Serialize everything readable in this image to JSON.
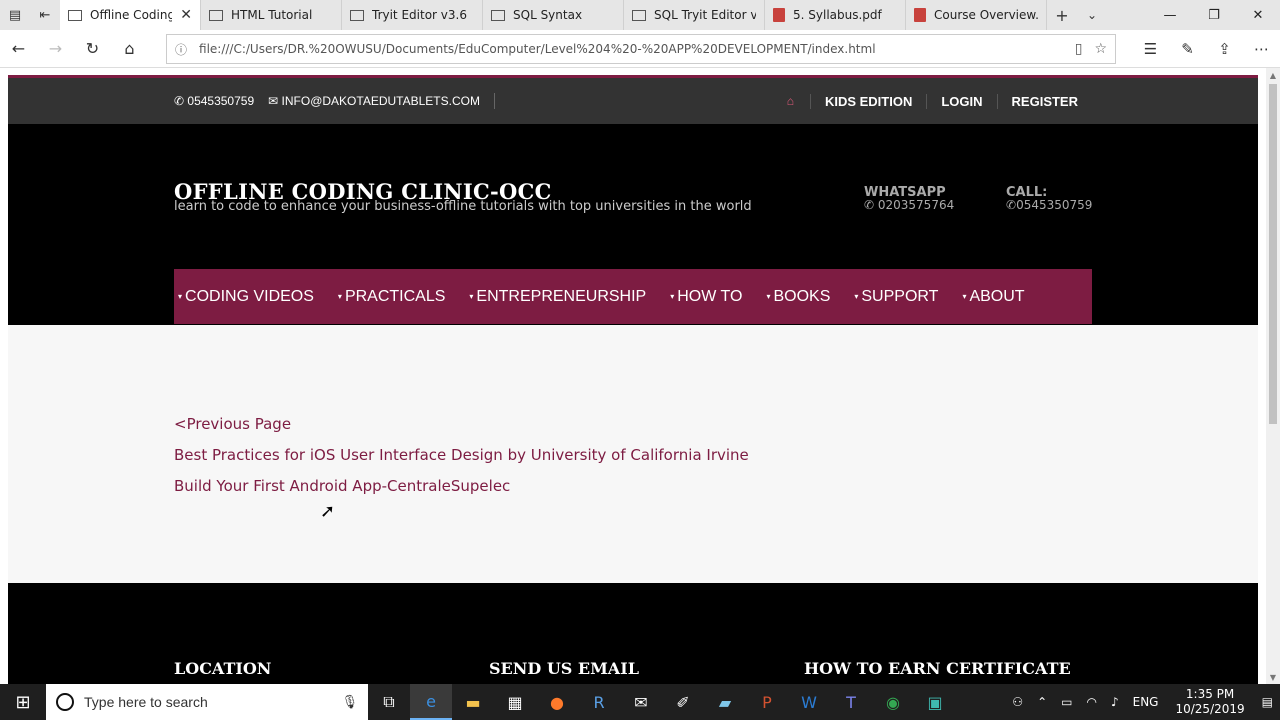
{
  "browser": {
    "tabs": [
      {
        "title": "Offline Coding",
        "type": "page",
        "active": true
      },
      {
        "title": "HTML Tutorial",
        "type": "page",
        "active": false
      },
      {
        "title": "Tryit Editor v3.6",
        "type": "page",
        "active": false
      },
      {
        "title": "SQL Syntax",
        "type": "page",
        "active": false
      },
      {
        "title": "SQL Tryit Editor v1.",
        "type": "page",
        "active": false
      },
      {
        "title": "5. Syllabus.pdf",
        "type": "pdf",
        "active": false
      },
      {
        "title": "Course Overview.p",
        "type": "pdf",
        "active": false
      }
    ],
    "url": "file:///C:/Users/DR.%20OWUSU/Documents/EduComputer/Level%204%20-%20APP%20DEVELOPMENT/index.html"
  },
  "site": {
    "phone": "0545350759",
    "email": "INFO@DAKOTAEDUTABLETS.COM",
    "top_links": [
      "KIDS EDITION",
      "LOGIN",
      "REGISTER"
    ],
    "brand": "OFFLINE CODING CLINIC-OCC",
    "tagline": "learn to code to enhance your business-offline tutorials with top universities in the world",
    "whatsapp_label": "WHATSAPP",
    "whatsapp_number": "0203575764",
    "call_label": "CALL:",
    "call_number": "0545350759",
    "menu": [
      "CODING VIDEOS",
      "PRACTICALS",
      "ENTREPRENEURSHIP",
      "HOW TO",
      "BOOKS",
      "SUPPORT",
      "ABOUT"
    ],
    "links": [
      "<Previous Page",
      "Best Practices for iOS User Interface Design by University of California Irvine",
      "Build Your First Android App-CentraleSupelec"
    ],
    "footer_headings": [
      "LOCATION",
      "SEND US EMAIL",
      "HOW TO EARN CERTIFICATE"
    ],
    "accent_color": "#7d1c42"
  },
  "taskbar": {
    "search_placeholder": "Type here to search",
    "language": "ENG",
    "time": "1:35 PM",
    "date": "10/25/2019"
  }
}
